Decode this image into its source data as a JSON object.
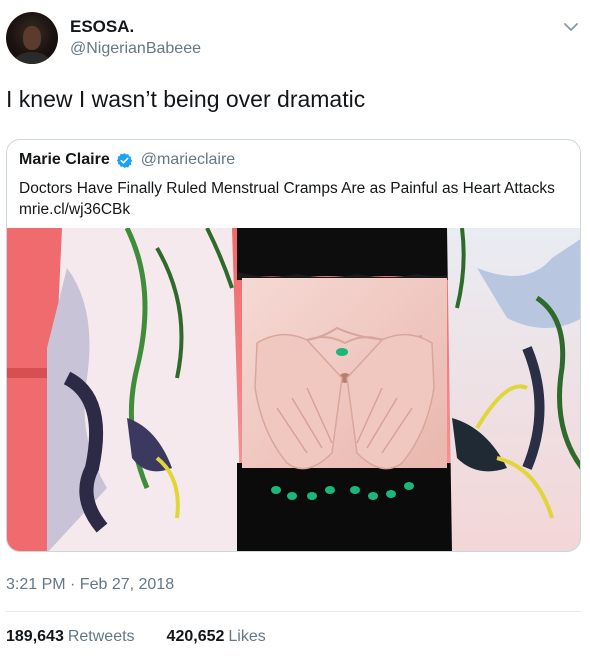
{
  "author": {
    "name": "ESOSA.",
    "handle": "@NigerianBabeee"
  },
  "tweet": {
    "text": "I knew I wasn’t being over dramatic"
  },
  "quoted": {
    "name": "Marie Claire",
    "handle": "@marieclaire",
    "text": "Doctors Have Finally Ruled Menstrual Cramps Are as Painful as Heart Attacks mrie.cl/wj36CBk",
    "verified": true
  },
  "meta": {
    "timestamp": "3:21 PM · Feb 27, 2018"
  },
  "stats": {
    "retweets_count": "189,643",
    "retweets_label": "Retweets",
    "likes_count": "420,652",
    "likes_label": "Likes"
  },
  "colors": {
    "verified_blue": "#1da1f2",
    "muted": "#657786",
    "text": "#14171a",
    "nail_green": "#19b77a"
  },
  "icons": {
    "more": "chevron-down-icon",
    "verified": "verified-badge-icon"
  }
}
